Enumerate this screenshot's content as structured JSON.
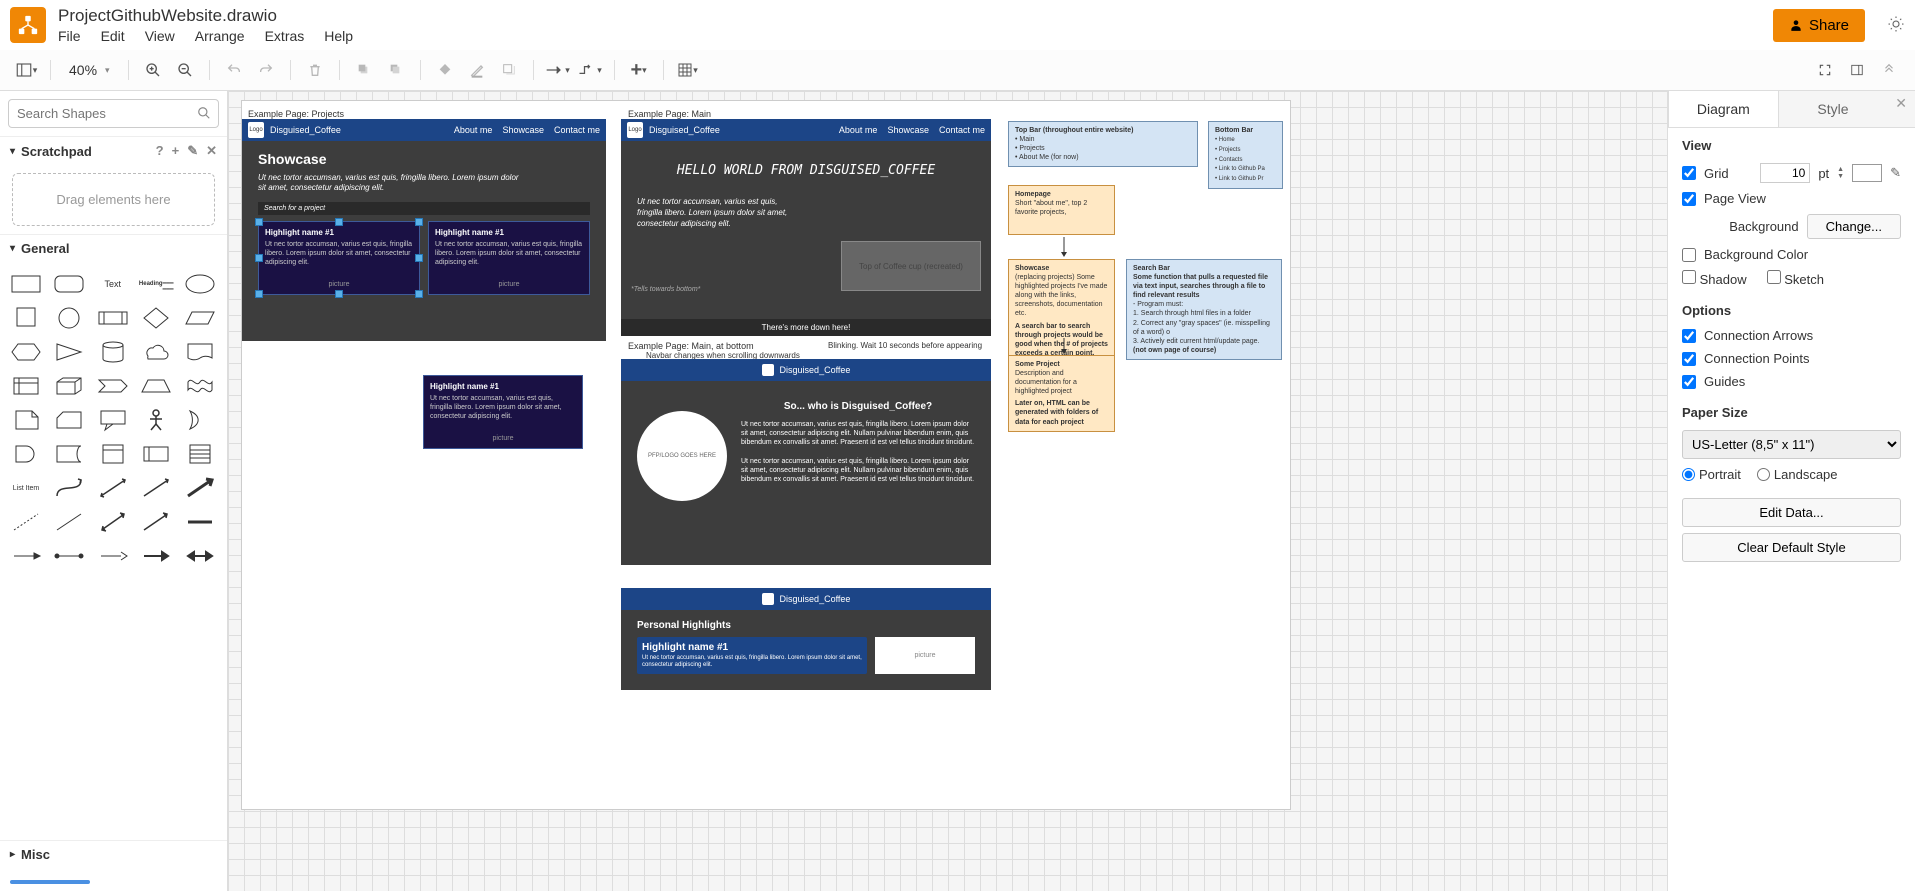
{
  "doc_title": "ProjectGithubWebsite.drawio",
  "menu": {
    "file": "File",
    "edit": "Edit",
    "view": "View",
    "arrange": "Arrange",
    "extras": "Extras",
    "help": "Help"
  },
  "share_label": "Share",
  "toolbar": {
    "zoom": "40%"
  },
  "search_shapes_placeholder": "Search Shapes",
  "scratchpad": {
    "title": "Scratchpad",
    "drag_hint": "Drag elements here"
  },
  "general_title": "General",
  "shape_text_label": "Text",
  "shape_heading_label": "Heading",
  "shape_listitem_label": "List Item",
  "misc_title": "Misc",
  "tabs": {
    "diagram": "Diagram",
    "style": "Style"
  },
  "right": {
    "view": "View",
    "grid": "Grid",
    "grid_val": "10",
    "grid_unit": "pt",
    "page_view": "Page View",
    "background": "Background",
    "change": "Change...",
    "bg_color": "Background Color",
    "shadow": "Shadow",
    "sketch": "Sketch",
    "options": "Options",
    "conn_arrows": "Connection Arrows",
    "conn_points": "Connection Points",
    "guides": "Guides",
    "paper_size": "Paper Size",
    "paper_opt": "US-Letter (8,5\" x 11\")",
    "portrait": "Portrait",
    "landscape": "Landscape",
    "edit_data": "Edit Data...",
    "clear_style": "Clear Default Style"
  },
  "canvas": {
    "label_projects": "Example Page: Projects",
    "label_main": "Example Page: Main",
    "label_main_bottom": "Example Page: Main, at bottom",
    "navbar_name": "Disguised_Coffee",
    "navbar_logo": "Logo",
    "nav_about": "About me",
    "nav_showcase": "Showcase",
    "nav_contact": "Contact me",
    "showcase_title": "Showcase",
    "lorem1": "Ut nec tortor accumsan, varius est quis, fringilla libero. Lorem ipsum dolor sit amet, consectetur adipiscing elit.",
    "search_proj": "Search for a project",
    "highlight_title": "Highlight name #1",
    "highlight_body": "Ut nec tortor accumsan, varius est quis, fringilla libero. Lorem ipsum dolor sit amet, consectetur adipiscing elit.",
    "picture": "picture",
    "hello": "HELLO WORLD FROM DISGUISED_COFFEE",
    "fade_note": "*Tells towards bottom*",
    "coffee_cup": "Top of Coffee cup (recreated)",
    "more_down": "There's more down here!",
    "blink_note": "Blinking. Wait 10 seconds before appearing",
    "navbar_note": "Navbar changes when scrolling downwards",
    "who_title": "So... who is Disguised_Coffee?",
    "pfp_label": "PFP/LOGO GOES HERE",
    "who_body1": "Ut nec tortor accumsan, varius est quis, fringilla libero. Lorem ipsum dolor sit amet, consectetur adipiscing elit. Nullam pulvinar bibendum enim, quis bibendum ex convallis sit amet. Praesent id est vel tellus tincidunt tincidunt.",
    "who_body2": "Ut nec tortor accumsan, varius est quis, fringilla libero. Lorem ipsum dolor sit amet, consectetur adipiscing elit. Nullam pulvinar bibendum enim, quis bibendum ex convallis sit amet. Praesent id est vel tellus tincidunt tincidunt.",
    "personal_hl": "Personal Highlights",
    "topbar_title": "Top Bar (throughout entire website)",
    "topbar_items": "• Main\n• Projects\n• About Me (for now)",
    "bottombar_title": "Bottom Bar",
    "bottombar_items": "• Home\n• Projects\n• Contacts\n• Link to Github Pa\n• Link to Github Pr",
    "homepage_title": "Homepage",
    "homepage_body": "Short \"about me\", top 2 favorite projects,",
    "showcase_note_title": "Showcase",
    "showcase_note_body": "(replacing projects)\nSome highlighted projects I've made along with the links, screenshots, documentation etc.",
    "showcase_note_body2": "A search bar to search through projects would be good when the # of projects exceeds a certain point.",
    "someproj_title": "Some Project",
    "someproj_body": "Description and documentation for a highlighted project",
    "someproj_body2": "Later on, HTML can be generated with folders of data for each project",
    "searchbar_title": "Search Bar",
    "searchbar_body": "Some function that pulls a requested file via text input, searches through a file to find relevant results",
    "searchbar_list": "- Program must:\n1. Search through html files in a folder\n2. Correct any \"gray spaces\" (ie. misspelling of a word) o\n3. Actively edit current html/update page.",
    "searchbar_foot": "(not own page of course)"
  }
}
